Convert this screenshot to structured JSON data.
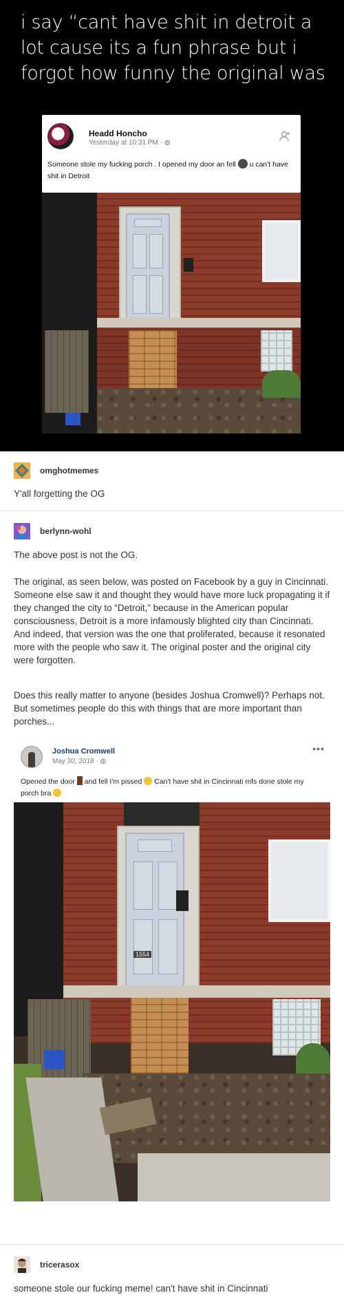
{
  "meme": {
    "caption": "i say “cant have shit in detroit a lot cause its a fun phrase but i forgot how funny the original was",
    "fb_post": {
      "name": "Headd Honcho",
      "meta": "Yesterday at 10:31 PM · ",
      "text_part1": "Someone stole my fucking porch . I opened my door an fell ",
      "text_part2": " u can't have shit in Detroit"
    }
  },
  "posts": [
    {
      "user": "omghotmemes",
      "text": "Y'all forgetting the OG"
    },
    {
      "user": "berlynn-wohl",
      "paragraphs": [
        "The above post is not the OG.",
        "The original, as seen below, was posted on Facebook by a guy in Cincinnati. Someone else saw it and thought they would have more luck propagating it if they changed the city to “Detroit,” because in the American popular consciousness, Detroit is a more infamously blighted city than Cincinnati. And indeed, that version was the one that proliferated, because it resonated more with the people who saw it. The original poster and the original city were forgotten.",
        "Does this really matter to anyone (besides Joshua Cromwell)? Perhaps not. But sometimes people do this with things that are more important than porches..."
      ],
      "og_post": {
        "name": "Joshua Cromwell",
        "meta": "May 30, 2018 · ",
        "more": "•••",
        "text_part1": "Opened the door ",
        "text_part2": " and fell I'm pissed ",
        "text_part3": " Can't have shit in Cincinnati mfs done stole my porch bra "
      },
      "house_number": "1554"
    },
    {
      "user": "tricerasox",
      "text": "someone stole our fucking meme! can't have shit in Cincinnati"
    }
  ],
  "colors": {
    "meme_bg": "#000000",
    "brick": "#8c3a2a",
    "door": "#c9d2dc",
    "fb_name_link": "#1b3c7a"
  }
}
